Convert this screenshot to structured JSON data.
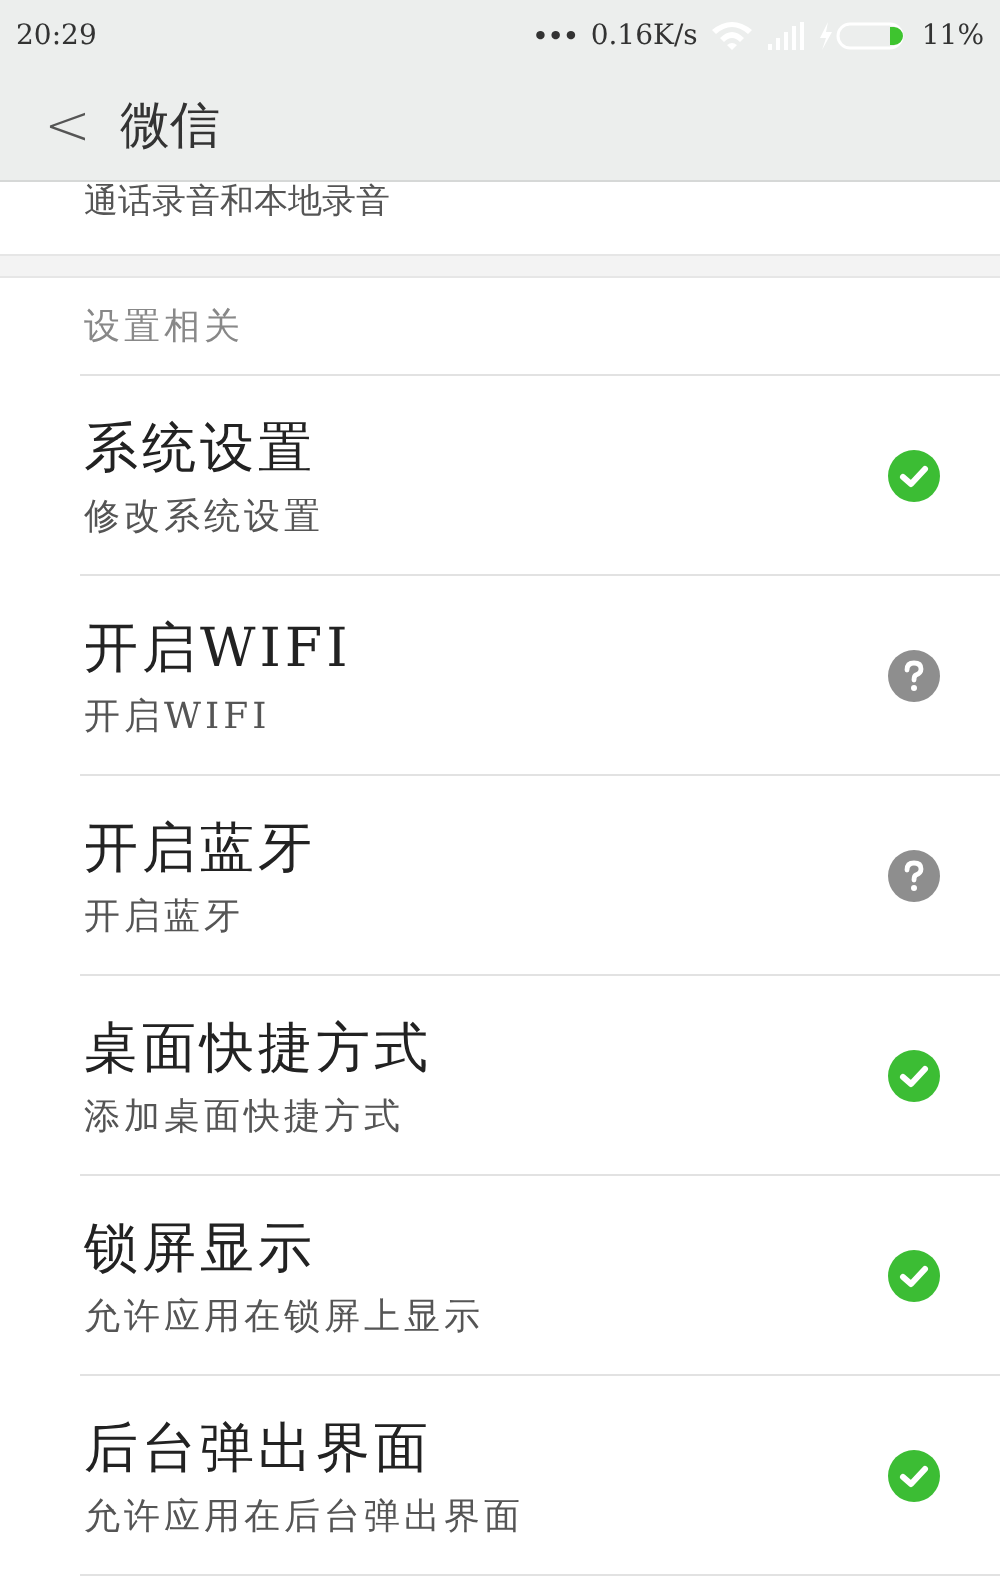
{
  "status_bar": {
    "time": "20:29",
    "dots": "•••",
    "speed": "0.16K/s",
    "battery": "11%"
  },
  "header": {
    "back": "<",
    "title": "微信"
  },
  "partial_row": {
    "subtitle": "通话录音和本地录音"
  },
  "section": {
    "title": "设置相关"
  },
  "items": [
    {
      "title": "系统设置",
      "subtitle": "修改系统设置",
      "granted": true
    },
    {
      "title": "开启WIFI",
      "subtitle": "开启WIFI",
      "granted": false
    },
    {
      "title": "开启蓝牙",
      "subtitle": "开启蓝牙",
      "granted": false
    },
    {
      "title": "桌面快捷方式",
      "subtitle": "添加桌面快捷方式",
      "granted": true
    },
    {
      "title": "锁屏显示",
      "subtitle": "允许应用在锁屏上显示",
      "granted": true
    },
    {
      "title": "后台弹出界面",
      "subtitle": "允许应用在后台弹出界面",
      "granted": true
    }
  ]
}
